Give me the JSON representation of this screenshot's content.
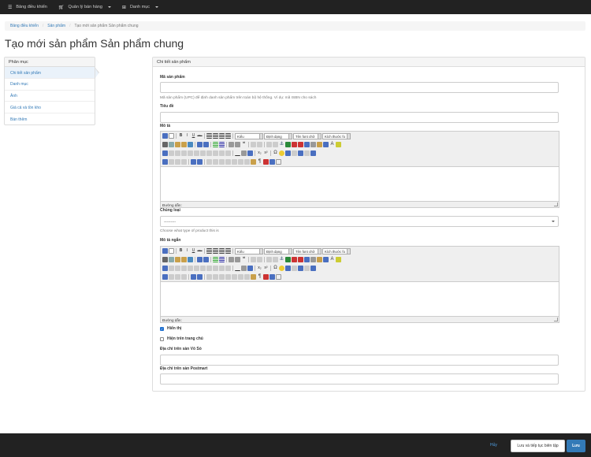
{
  "navbar": {
    "items": [
      {
        "icon": "list-icon",
        "label": "Bảng điều khiển"
      },
      {
        "icon": "cart-icon",
        "label": "Quản lý bán hàng"
      },
      {
        "icon": "sitemap-icon",
        "label": "Danh mục"
      }
    ]
  },
  "breadcrumb": [
    "Bảng điều khiển",
    "Sản phẩm",
    "Tạo mới sản phẩm Sản phẩm chung"
  ],
  "page_title": "Tạo mới sản phẩm Sản phẩm chung",
  "left_panel": {
    "heading": "Phân mục",
    "items": [
      "Chi tiết sản phẩm",
      "Danh mục",
      "Ảnh",
      "Giá cả và tồn kho",
      "Bán thêm"
    ]
  },
  "right_panel": {
    "heading": "Chi tiết sản phẩm",
    "sku_label": "Mã sản phẩm",
    "sku_help": "Mã sản phẩm (UPC) để định danh sản phẩm trên toàn bộ hệ thống. Ví dụ: mã ISBN cho sách",
    "title_label": "Tiêu đề",
    "desc_label": "Mô tả",
    "class_label": "Chủng loại",
    "class_value": "---------",
    "class_help": "Choose what type of product this is",
    "short_desc_label": "Mô tả ngắn",
    "show_label": "Hiển thị",
    "show_checked": true,
    "homepage_label": "Hiện trên trang chủ",
    "homepage_checked": false,
    "vosó_label": "Địa chỉ trên sàn Vỏ Sò",
    "postmart_label": "Địa chỉ trên sàn Postmart"
  },
  "editor": {
    "style_dd": "Kiểu",
    "format_dd": "Định dạng",
    "font_dd": "Tên font chữ",
    "size_dd": "Kích thước fo",
    "path_label": "Đường dẫn:",
    "btn_bold": "B",
    "btn_italic": "I",
    "btn_underline": "U",
    "btn_strike": "ABC"
  },
  "footer": {
    "cancel": "Hủy",
    "save_continue": "Lưu và tiếp tục biên tập",
    "save": "Lưu"
  }
}
